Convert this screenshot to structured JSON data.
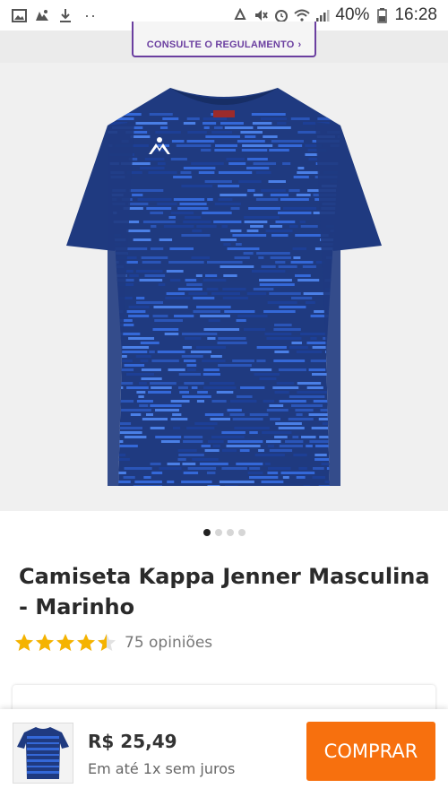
{
  "status_bar": {
    "battery": "40%",
    "time": "16:28",
    "left_icons": [
      "image-icon",
      "sync-icon",
      "download-icon",
      "more-dots-icon"
    ],
    "right_icons": [
      "recycle-icon",
      "mute-icon",
      "alarm-icon",
      "wifi-icon",
      "signal-icon",
      "battery-icon"
    ]
  },
  "banner": {
    "rules_label": "CONSULTE O REGULAMENTO",
    "rules_chevron": "›"
  },
  "product": {
    "title": "Camiseta Kappa Jenner Masculina - Marinho",
    "rating": 4.5,
    "rating_max": 5,
    "reviews": "75 opiniões",
    "image_count": 4,
    "active_image": 1
  },
  "buy_bar": {
    "price": "R$ 25,49",
    "installments": "Em até 1x sem juros",
    "button_label": "COMPRAR"
  },
  "colors": {
    "accent": "#f7700e",
    "star": "#f5b300",
    "shirt_navy": "#1f3a80",
    "shirt_blue": "#3468d8",
    "rules_purple": "#6b3fa0"
  }
}
